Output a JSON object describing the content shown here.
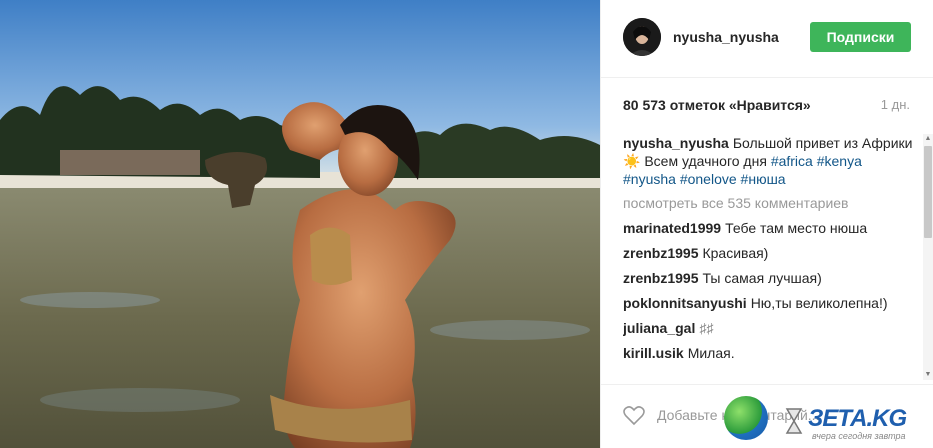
{
  "header": {
    "username": "nyusha_nyusha",
    "follow_label": "Подписки"
  },
  "stats": {
    "likes": "80 573 отметок «Нравится»",
    "time": "1 дн."
  },
  "caption": {
    "user": "nyusha_nyusha",
    "text": "Большой привет из Африки☀️ Всем удачного дня",
    "tags": [
      "#africa",
      "#kenya",
      "#nyusha",
      "#onelove",
      "#нюша"
    ]
  },
  "view_all": "посмотреть все 535 комментариев",
  "comments": [
    {
      "user": "marinated1999",
      "text": "Тебе там место нюша"
    },
    {
      "user": "zrenbz1995",
      "text": "Красивая)"
    },
    {
      "user": "zrenbz1995",
      "text": "Ты самая лучшая)"
    },
    {
      "user": "poklonnitsanyushi",
      "text": "Ню,ты великолепна!)"
    },
    {
      "user": "juliana_gal",
      "text": "♯♯"
    },
    {
      "user": "kirill.usik",
      "text": "Милая."
    }
  ],
  "footer": {
    "add_comment_placeholder": "Добавьте комментарий..."
  },
  "watermark": {
    "brand": "ЗЕТА.KG",
    "tagline": "вчера сегодня завтра"
  }
}
